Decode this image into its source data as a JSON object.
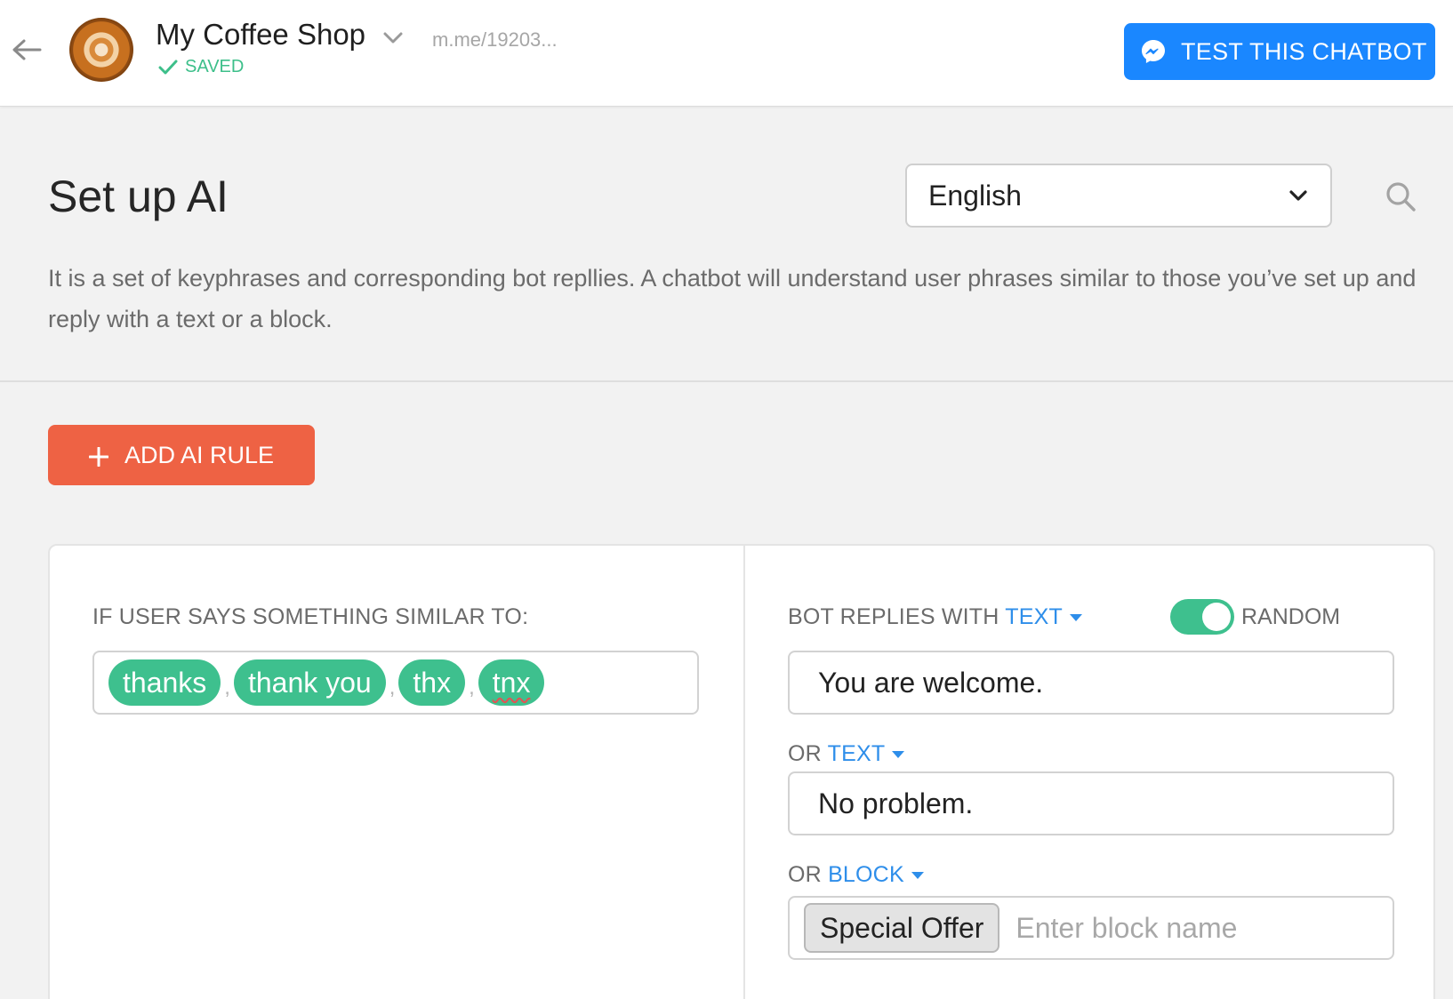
{
  "header": {
    "bot_name": "My Coffee Shop",
    "saved_label": "SAVED",
    "bot_link": "m.me/19203...",
    "test_button_label": "TEST THIS CHATBOT"
  },
  "page": {
    "title": "Set up AI",
    "language": "English",
    "description": "It is a set of keyphrases and corresponding bot repllies. A chatbot will understand user phrases similar to those you’ve set up and reply with a text or a block."
  },
  "add_rule_label": "ADD AI RULE",
  "rule": {
    "user_label": "IF USER SAYS SOMETHING SIMILAR TO:",
    "phrases": [
      "thanks",
      "thank you",
      "thx",
      "tnx"
    ],
    "separator": ",",
    "bot_label_prefix": "BOT REPLIES WITH",
    "bot_label_type": "TEXT",
    "random_label": "RANDOM",
    "random_enabled": true,
    "reply_1": "You are welcome.",
    "or_prefix": "OR",
    "reply_2_type": "TEXT",
    "reply_2": "No problem.",
    "reply_3_type": "BLOCK",
    "block_name": "Special Offer",
    "block_placeholder": "Enter block name"
  },
  "colors": {
    "accent_blue": "#1a87ff",
    "link_blue": "#2e8eea",
    "green": "#3ec08e",
    "add_button": "#ee6244"
  },
  "icons": [
    "back-arrow-icon",
    "chevron-down-icon",
    "check-icon",
    "messenger-icon",
    "search-icon",
    "plus-icon",
    "caret-down-icon"
  ]
}
